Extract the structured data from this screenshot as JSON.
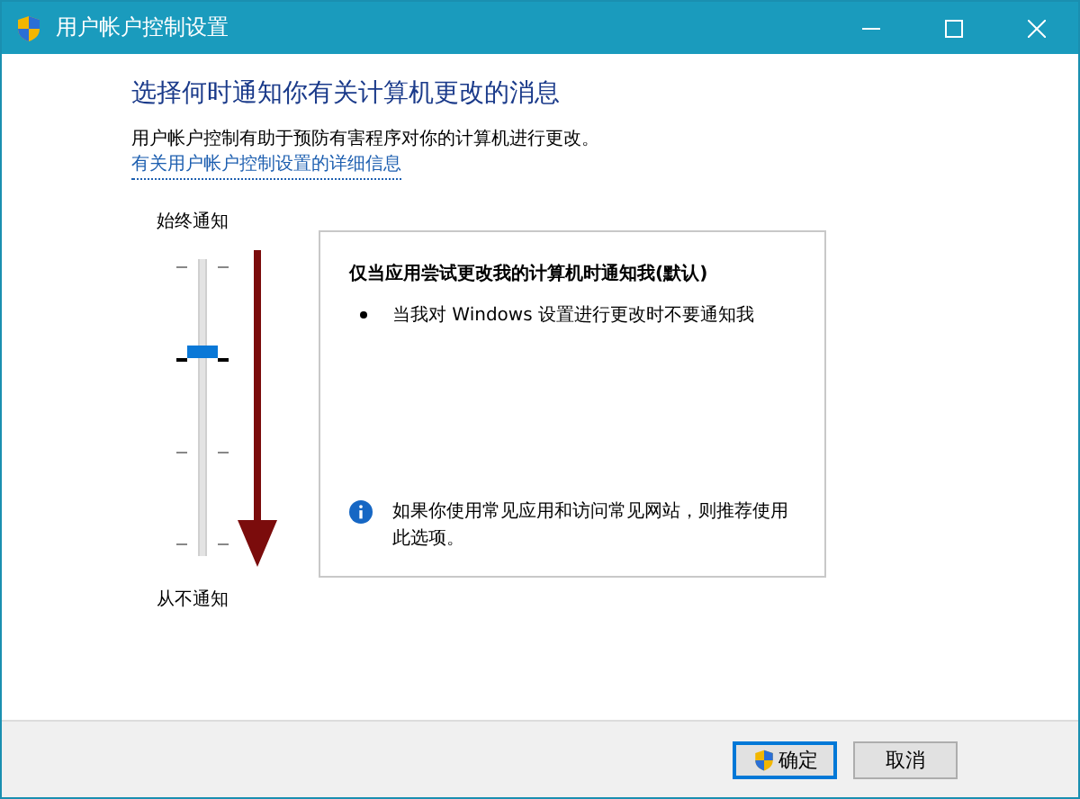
{
  "window": {
    "title": "用户帐户控制设置"
  },
  "heading": "选择何时通知你有关计算机更改的消息",
  "description": "用户帐户控制有助于预防有害程序对你的计算机进行更改。",
  "link": "有关用户帐户控制设置的详细信息",
  "slider": {
    "top_label": "始终通知",
    "bottom_label": "从不通知",
    "level": 0.667
  },
  "panel": {
    "title": "仅当应用尝试更改我的计算机时通知我(默认)",
    "bullets": [
      "当我对 Windows 设置进行更改时不要通知我"
    ],
    "note": "如果你使用常见应用和访问常见网站，则推荐使用此选项。"
  },
  "buttons": [
    {
      "label": "确定",
      "default": true,
      "shield": true
    },
    {
      "label": "取消",
      "default": false,
      "shield": false
    }
  ]
}
